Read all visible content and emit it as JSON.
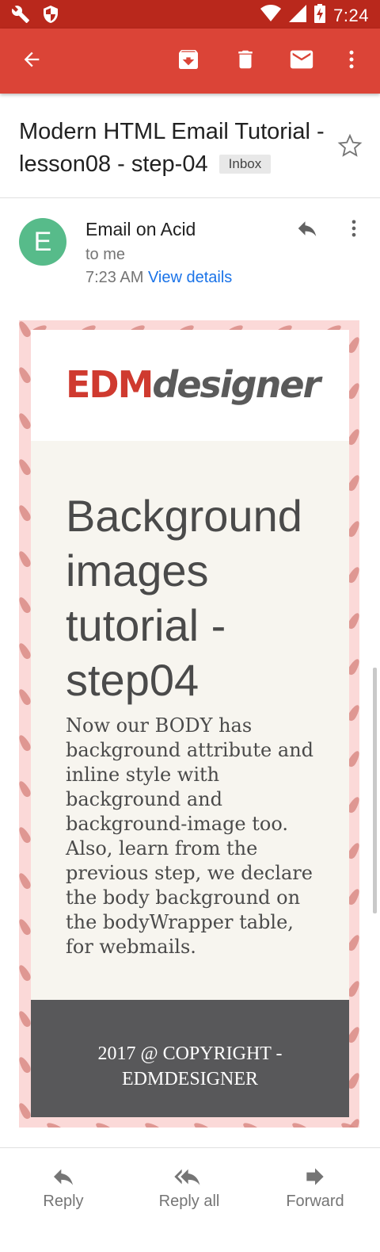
{
  "status_bar": {
    "time": "7:24",
    "icons": [
      "wrench-icon",
      "shield-icon",
      "wifi-icon",
      "cellular-signal-icon",
      "battery-icon"
    ]
  },
  "app_bar": {
    "color": "#db4437",
    "actions": [
      "back-arrow-icon",
      "archive-icon",
      "delete-icon",
      "mark-unread-icon",
      "more-vert-icon"
    ]
  },
  "email": {
    "subject": "Modern HTML Email Tutorial - lesson08 - step-04",
    "label": "Inbox",
    "sender": {
      "initial": "E",
      "name": "Email on Acid",
      "recipient": "to me",
      "time": "7:23 AM",
      "details_link": "View details",
      "avatar_color": "#57bb8a"
    }
  },
  "email_body": {
    "logo": {
      "part1": "EDM",
      "part2": "designer"
    },
    "headline": "Background images tutorial - step04",
    "paragraph": "Now our BODY has background attribute and inline style with background and background-image too. Also, learn from the previous step, we declare the body background on the bodyWrapper table, for webmails.",
    "footer": "2017 @ COPYRIGHT - EDMDESIGNER"
  },
  "bottom_actions": {
    "reply": "Reply",
    "reply_all": "Reply all",
    "forward": "Forward"
  }
}
